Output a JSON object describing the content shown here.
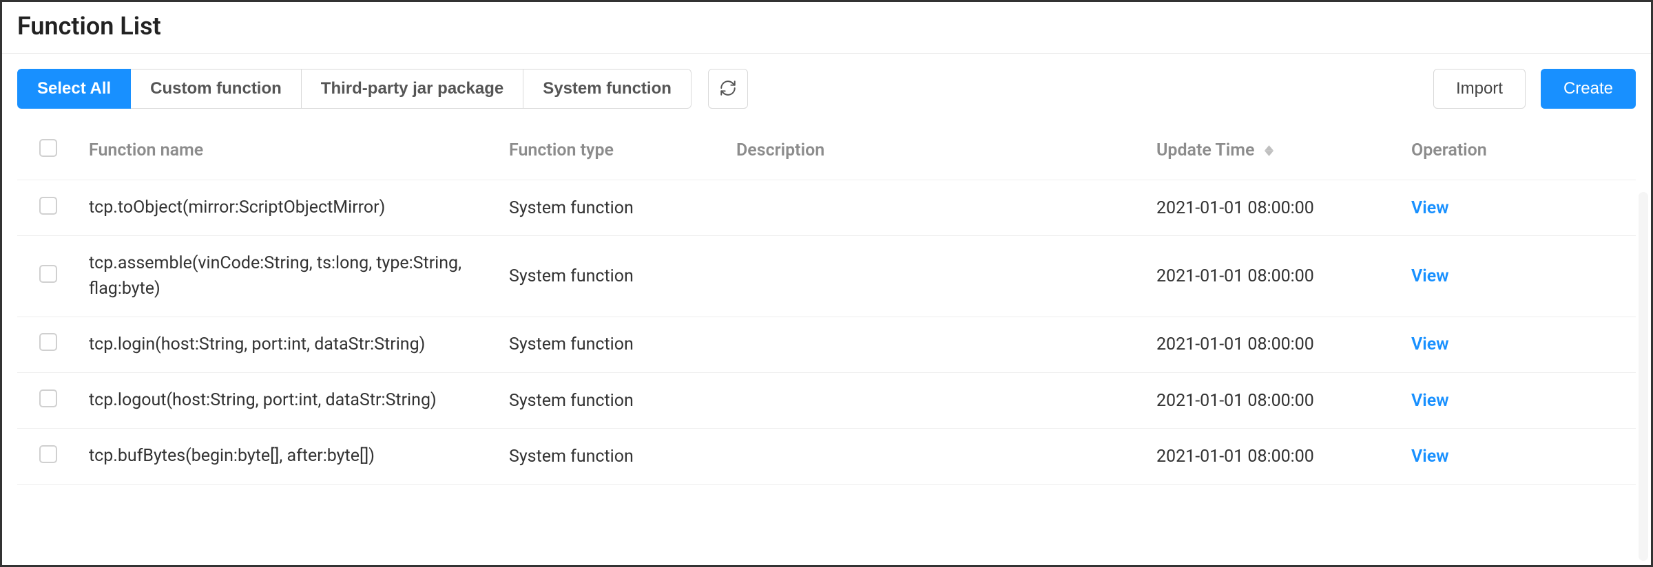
{
  "page_title": "Function List",
  "toolbar": {
    "tabs": [
      {
        "label": "Select All",
        "selected": true
      },
      {
        "label": "Custom function",
        "selected": false
      },
      {
        "label": "Third-party jar package",
        "selected": false
      },
      {
        "label": "System function",
        "selected": false
      }
    ],
    "import_label": "Import",
    "create_label": "Create"
  },
  "columns": {
    "name": "Function name",
    "type": "Function type",
    "description": "Description",
    "update_time": "Update Time",
    "operation": "Operation"
  },
  "rows": [
    {
      "name": "tcp.toObject(mirror:ScriptObjectMirror)",
      "type": "System function",
      "description": "",
      "update_time": "2021-01-01 08:00:00",
      "operation": "View"
    },
    {
      "name": "tcp.assemble(vinCode:String, ts:long, type:String, flag:byte)",
      "type": "System function",
      "description": "",
      "update_time": "2021-01-01 08:00:00",
      "operation": "View"
    },
    {
      "name": "tcp.login(host:String, port:int, dataStr:String)",
      "type": "System function",
      "description": "",
      "update_time": "2021-01-01 08:00:00",
      "operation": "View"
    },
    {
      "name": "tcp.logout(host:String, port:int, dataStr:String)",
      "type": "System function",
      "description": "",
      "update_time": "2021-01-01 08:00:00",
      "operation": "View"
    },
    {
      "name": "tcp.bufBytes(begin:byte[], after:byte[])",
      "type": "System function",
      "description": "",
      "update_time": "2021-01-01 08:00:00",
      "operation": "View"
    }
  ]
}
